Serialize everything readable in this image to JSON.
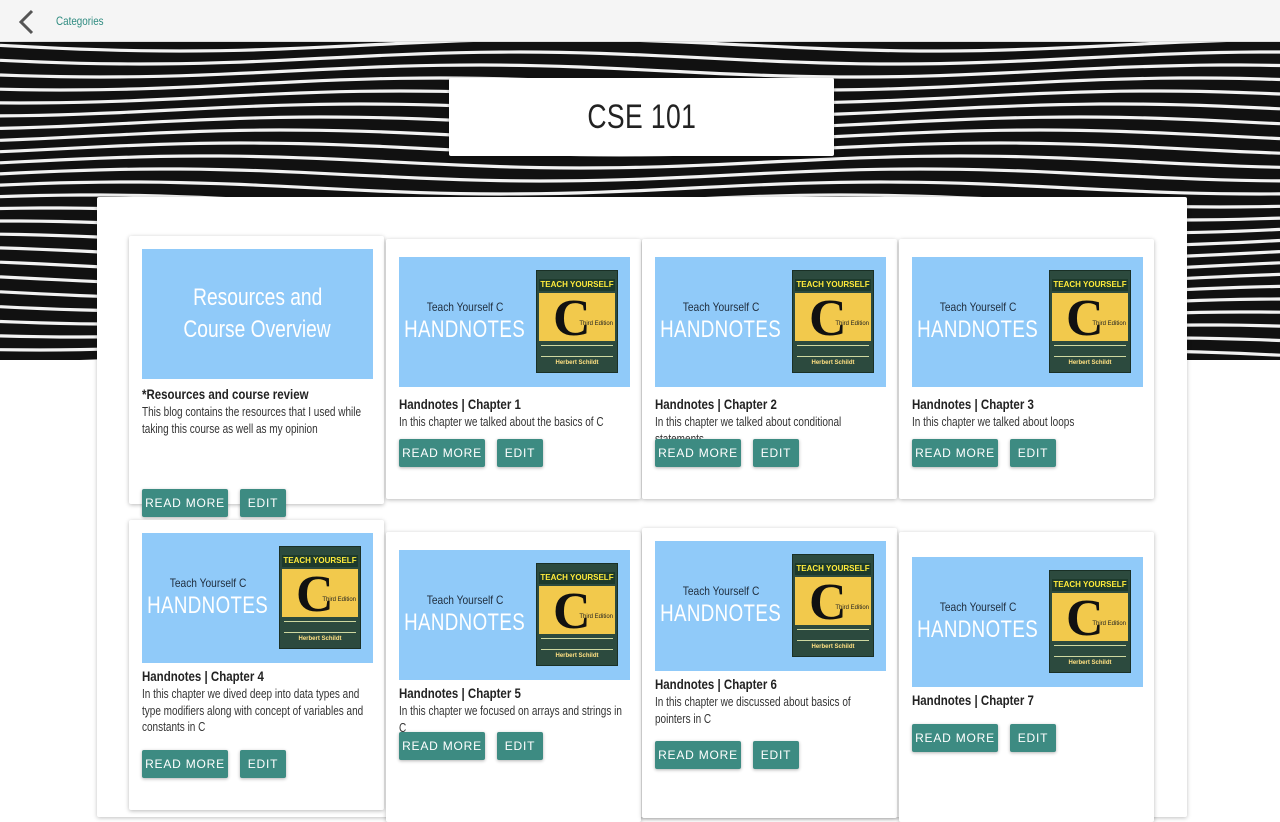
{
  "topbar": {
    "breadcrumb": "Categories"
  },
  "page_title": "CSE 101",
  "thumb_caption": {
    "small": "Teach Yourself C",
    "big": "HANDNOTES"
  },
  "book_cover": {
    "title": "TEACH YOURSELF",
    "letter": "C",
    "edition": "Third Edition",
    "author": "Herbert Schildt"
  },
  "buttons": {
    "read_more": "READ MORE",
    "edit": "EDIT"
  },
  "cards": [
    {
      "title": "*Resources and course review",
      "desc": "This blog contains the resources that I used while taking this course as well as my opinion",
      "thumb_lines": [
        "Resources and",
        "Course Overview"
      ]
    },
    {
      "title": "Handnotes | Chapter 1",
      "desc": "In this chapter we talked about the basics of C"
    },
    {
      "title": "Handnotes | Chapter 2",
      "desc": "In this chapter we talked about conditional statements"
    },
    {
      "title": "Handnotes | Chapter 3",
      "desc": "In this chapter we talked about loops"
    },
    {
      "title": "Handnotes | Chapter 4",
      "desc": "In this chapter we dived deep into data types and type modifiers along with concept of variables and constants in C"
    },
    {
      "title": "Handnotes | Chapter 5",
      "desc": "In this chapter we focused on arrays and strings in C"
    },
    {
      "title": "Handnotes | Chapter 6",
      "desc": "In this chapter we discussed about basics of pointers in C"
    },
    {
      "title": "Handnotes | Chapter 7",
      "desc": ""
    }
  ],
  "colors": {
    "accent": "#3d8b82",
    "thumb_bg": "#90caf9",
    "banner_dark": "#111111"
  }
}
